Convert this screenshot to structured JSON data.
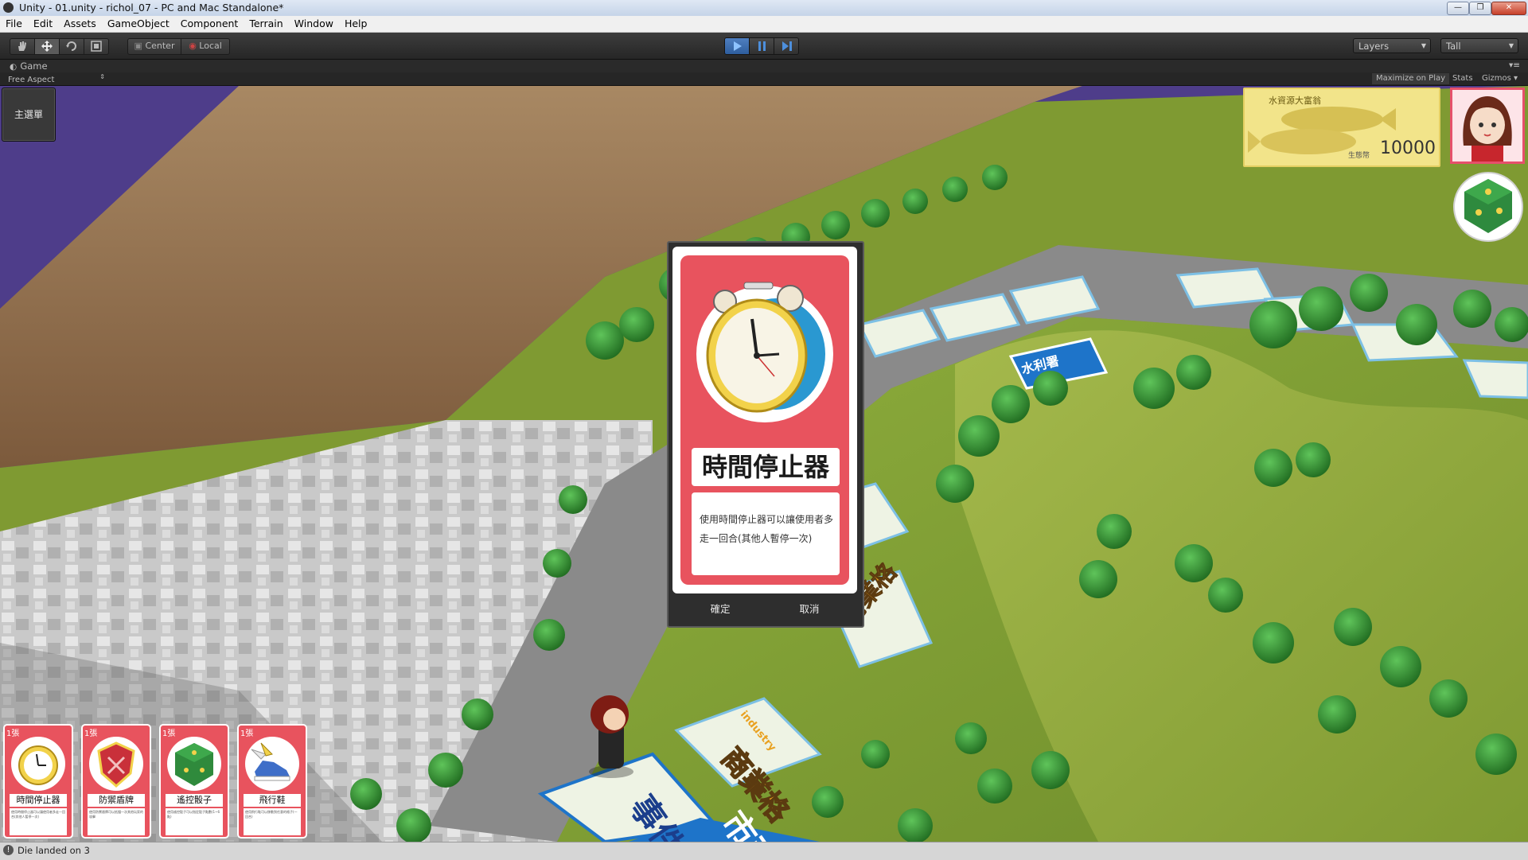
{
  "window": {
    "title": "Unity - 01.unity - richol_07 - PC and Mac Standalone*",
    "min_label": "—",
    "max_label": "❐",
    "close_label": "✕"
  },
  "menu": [
    "File",
    "Edit",
    "Assets",
    "GameObject",
    "Component",
    "Terrain",
    "Window",
    "Help"
  ],
  "toolbar": {
    "pivot_label": "Center",
    "space_label": "Local",
    "layers_label": "Layers",
    "layout_label": "Tall"
  },
  "game_view": {
    "tab_label": "Game",
    "aspect_label": "Free Aspect",
    "maximize_label": "Maximize on Play",
    "stats_label": "Stats",
    "gizmos_label": "Gizmos"
  },
  "hud": {
    "main_menu_label": "主選單",
    "money": {
      "title": "水資源大富翁",
      "currency_label": "生態幣",
      "amount": "10000"
    }
  },
  "dialog": {
    "card_name": "時間停止器",
    "card_description": "使用時間停止器可以讓使用者多走一回合(其他人暫停一次)",
    "confirm_label": "確定",
    "cancel_label": "取消"
  },
  "board_tiles": {
    "event": "事件格",
    "industry": "商業格",
    "industry_en": "industry",
    "city": "市政",
    "water": "水利署"
  },
  "hand": [
    {
      "count": "1張",
      "name": "時間停止器",
      "desc": "使用時間停止器可以讓使用者多走一回合(其他人暫停一次)",
      "art_color": "#f2d24a"
    },
    {
      "count": "1張",
      "name": "防禦盾牌",
      "desc": "使用防禦盾牌可以抵擋一次其他玩家的攻擊",
      "art_color": "#c9303a"
    },
    {
      "count": "1張",
      "name": "遙控骰子",
      "desc": "使用遙控骰子可以指定骰子點數(1~6點)",
      "art_color": "#2f8a3c"
    },
    {
      "count": "1張",
      "name": "飛行鞋",
      "desc": "使用飛行鞋可以移動到任意的格子(一回合)",
      "art_color": "#3e6ec8"
    }
  ],
  "status": {
    "message": "Die landed on 3"
  },
  "colors": {
    "card_red": "#e8535e",
    "sky_purple": "#4e3d8a",
    "grass": "#93ad3f",
    "road": "#8a8a8a"
  }
}
